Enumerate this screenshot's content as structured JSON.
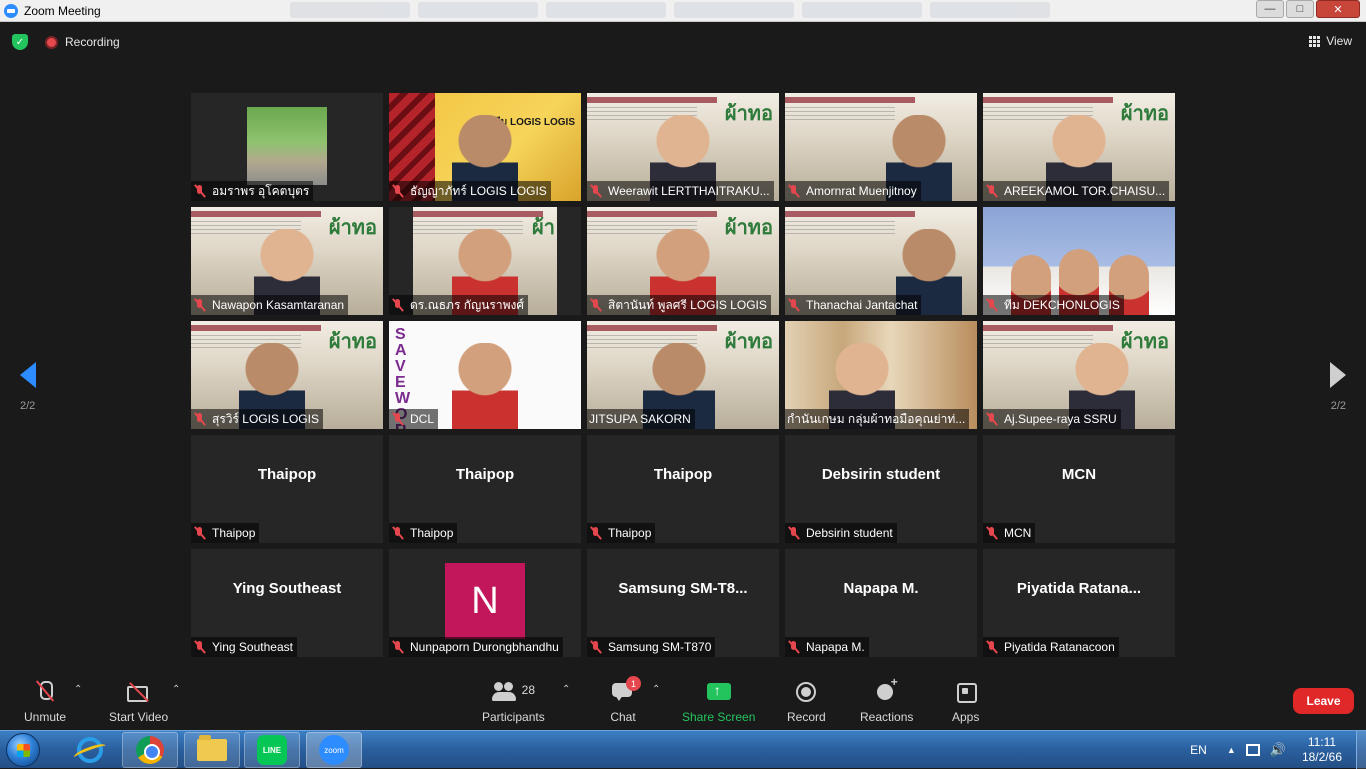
{
  "window": {
    "title": "Zoom Meeting"
  },
  "topbar": {
    "recording_label": "Recording",
    "view_label": "View"
  },
  "paging": {
    "left_page": "2/2",
    "right_page": "2/2"
  },
  "tiles": [
    {
      "name": "อมราพร อุโคตบุตร"
    },
    {
      "name": "ธัญญาภัทร์ LOGIS LOGIS",
      "overlay": "ทีม LOGIS LOGIS"
    },
    {
      "name": "Weerawit LERTTHAITRAKU...",
      "overlay": "ผ้าทอ"
    },
    {
      "name": "Amornrat  Muenjitnoy"
    },
    {
      "name": "AREEKAMOL TOR.CHAISU...",
      "overlay": "ผ้าทอ"
    },
    {
      "name": "Nawapon Kasamtaranan",
      "overlay": "ผ้าทอ"
    },
    {
      "name": "ดร.ณธภร กัญนราพงศ์",
      "overlay": "ผ้า"
    },
    {
      "name": "สิตานันท์ พูลศรี LOGIS LOGIS",
      "overlay": "ผ้าทอ"
    },
    {
      "name": "Thanachai Jantachat"
    },
    {
      "name": "ทีม DEKCHONLOGIS"
    },
    {
      "name": "สุรวิร์ LOGIS LOGIS",
      "overlay": "ผ้าทอ"
    },
    {
      "name": "DCL",
      "overlay": "SAVE WORLD"
    },
    {
      "name": "JITSUPA  SAKORN",
      "overlay": "ผ้าทอ"
    },
    {
      "name": "กำนันเกษม กลุ่มผ้าทอมือคุณย่าท่..."
    },
    {
      "name": "Aj.Supee-raya SSRU",
      "overlay": "ผ้าทอ"
    },
    {
      "display": "Thaipop",
      "name": "Thaipop"
    },
    {
      "display": "Thaipop",
      "name": "Thaipop"
    },
    {
      "display": "Thaipop",
      "name": "Thaipop"
    },
    {
      "display": "Debsirin student",
      "name": "Debsirin student"
    },
    {
      "display": "MCN",
      "name": "MCN"
    },
    {
      "display": "Ying Southeast",
      "name": "Ying Southeast"
    },
    {
      "avatar_letter": "N",
      "name": "Nunpaporn Durongbhandhu"
    },
    {
      "display": "Samsung  SM-T8...",
      "name": "Samsung SM-T870"
    },
    {
      "display": "Napapa M.",
      "name": "Napapa M."
    },
    {
      "display": "Piyatida  Ratana...",
      "name": "Piyatida Ratanacoon"
    }
  ],
  "toolbar": {
    "unmute": "Unmute",
    "start_video": "Start Video",
    "participants_count": "28",
    "participants": "Participants",
    "chat_badge": "1",
    "chat": "Chat",
    "share_screen": "Share Screen",
    "record": "Record",
    "reactions": "Reactions",
    "apps": "Apps",
    "leave": "Leave"
  },
  "taskbar": {
    "line_label": "LINE",
    "zoom_label": "zoom",
    "language": "EN",
    "time": "11:11",
    "date": "18/2/66"
  },
  "colors": {
    "accent_blue": "#2d8cff",
    "share_green": "#23c45e",
    "leave_red": "#e02828",
    "mute_red": "#e4474d"
  }
}
